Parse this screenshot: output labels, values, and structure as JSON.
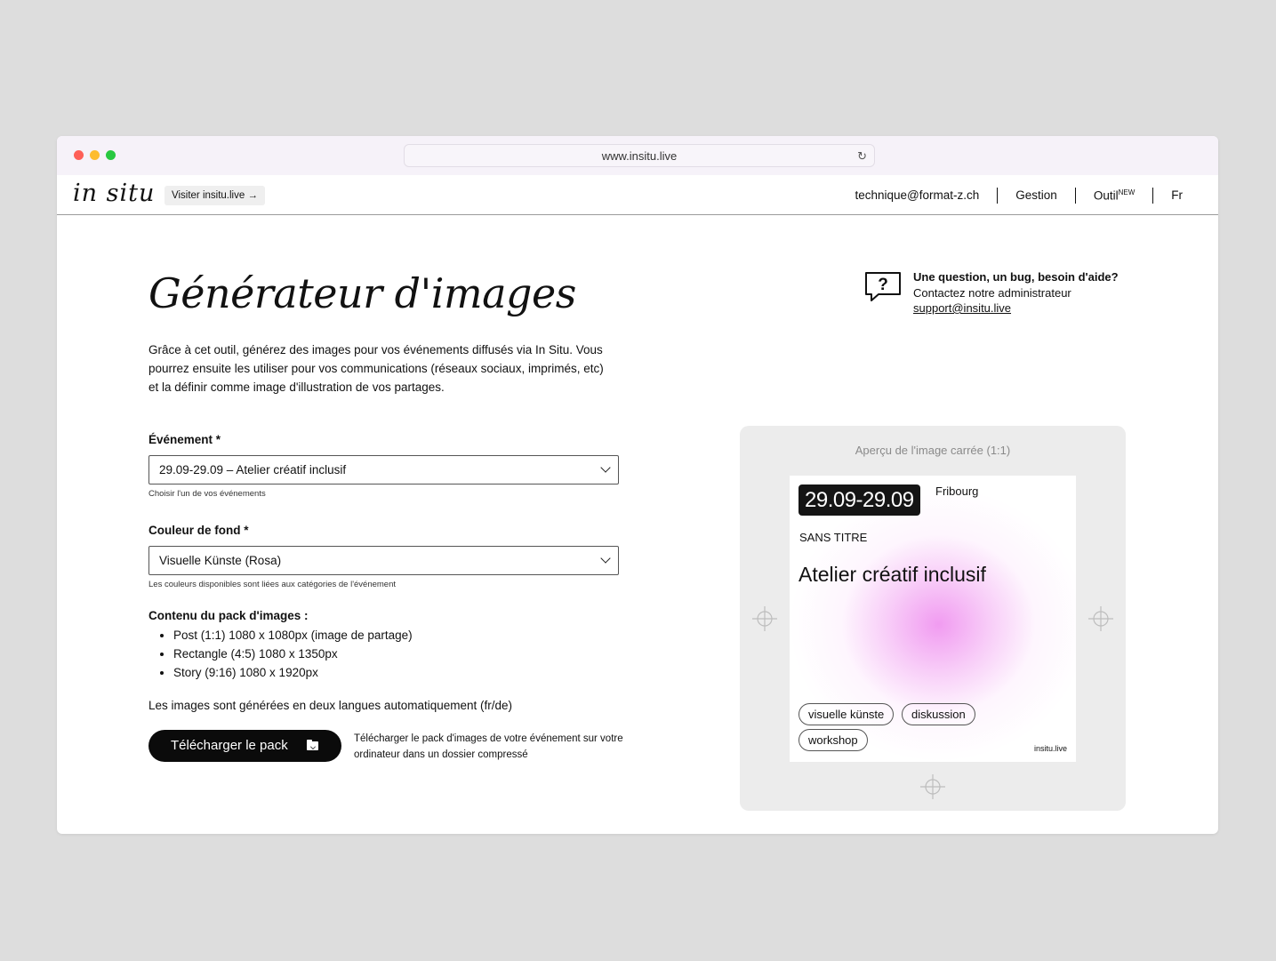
{
  "browser": {
    "url": "www.insitu.live",
    "reload_icon": "reload-icon"
  },
  "header": {
    "logo": "in situ",
    "visit_link": "Visiter insitu.live",
    "visit_arrow": "→",
    "nav": {
      "email": "technique@format-z.ch",
      "gestion": "Gestion",
      "outil": "Outil",
      "outil_badge": "NEW",
      "lang": "Fr"
    }
  },
  "main": {
    "title": "Générateur d'images",
    "intro": "Grâce à cet outil, générez des images pour vos événements diffusés via In Situ. Vous pourrez ensuite les utiliser pour vos communications (réseaux sociaux, imprimés, etc) et la définir comme image d'illustration de vos partages.",
    "event_field": {
      "label": "Événement *",
      "value": "29.09-29.09 – Atelier créatif inclusif",
      "help": "Choisir l'un de vos événements"
    },
    "color_field": {
      "label": "Couleur de fond *",
      "value": "Visuelle Künste (Rosa)",
      "help": "Les couleurs disponibles sont liées aux catégories de l'événement"
    },
    "pack": {
      "title": "Contenu du pack d'images :",
      "items": [
        "Post (1:1) 1080 x 1080px (image de partage)",
        "Rectangle (4:5) 1080 x 1350px",
        "Story (9:16) 1080 x 1920px"
      ]
    },
    "auto_lang": "Les images sont générées en deux langues automatiquement (fr/de)",
    "download_button": "Télécharger le pack",
    "download_desc": "Télécharger le pack d'images de votre événement sur votre ordinateur dans un dossier compressé"
  },
  "help": {
    "icon": "question-bubble-icon",
    "line1": "Une question, un bug, besoin d'aide?",
    "line2": "Contactez notre administrateur",
    "email": "support@insitu.live"
  },
  "preview": {
    "caption": "Aperçu de l'image carrée (1:1)",
    "card": {
      "date": "29.09-29.09",
      "city": "Fribourg",
      "organizer": "SANS TITRE",
      "title": "Atelier créatif inclusif",
      "tags": [
        "visuelle künste",
        "diskussion",
        "workshop"
      ],
      "footer": "insitu.live",
      "gradient_color": "#f096f0"
    }
  }
}
